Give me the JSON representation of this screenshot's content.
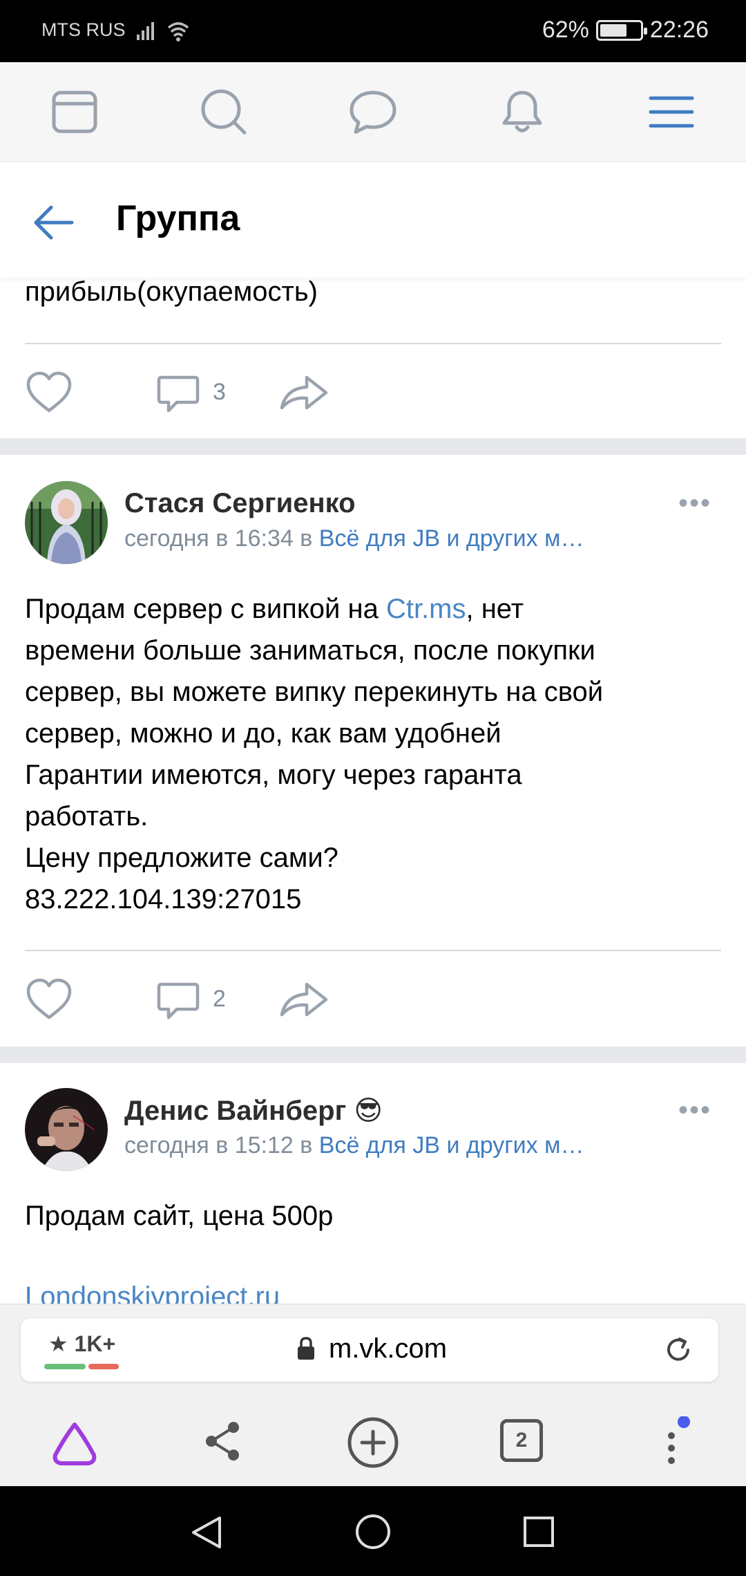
{
  "status_bar": {
    "carrier": "MTS RUS",
    "battery": "62%",
    "time": "22:26"
  },
  "top_nav": {
    "icons": [
      "feed-icon",
      "search-icon",
      "messages-icon",
      "notifications-icon",
      "menu-icon"
    ]
  },
  "header": {
    "title": "Группа"
  },
  "post0": {
    "text_tail": "прибыль(окупаемость)",
    "comments_count": "3"
  },
  "post1": {
    "author": "Стася Сергиенко",
    "time": "сегодня в 16:34 в",
    "group": "Всё для JB и других м…",
    "line1_prefix": "Продам сервер с випкой на ",
    "line1_link": "Ctr.ms",
    "line1_suffix": ", нет",
    "line2": "времени больше заниматься, после покупки",
    "line3": "сервер, вы можете випку перекинуть на свой",
    "line4": "сервер, можно и до, как вам удобней",
    "line5": "Гарантии имеются, могу через гаранта",
    "line6": "работать.",
    "line7": "Цену предложите сами?",
    "line8": "83.222.104.139:27015",
    "comments_count": "2"
  },
  "post2": {
    "author": "Денис Вайнберг 😎",
    "time": "сегодня в 15:12 в",
    "group": "Всё для JB и других м…",
    "text": "Продам сайт, цена 500р",
    "link_partial": "Londonskiyproject.ru"
  },
  "browser": {
    "rating": "★ 1K+",
    "url": "m.vk.com",
    "tabs_count": "2"
  },
  "colors": {
    "accent": "#4a86c5",
    "icon_blue": "#3f7cc0",
    "meta_gray": "#818c99",
    "alice_purple": "#a03be0"
  }
}
